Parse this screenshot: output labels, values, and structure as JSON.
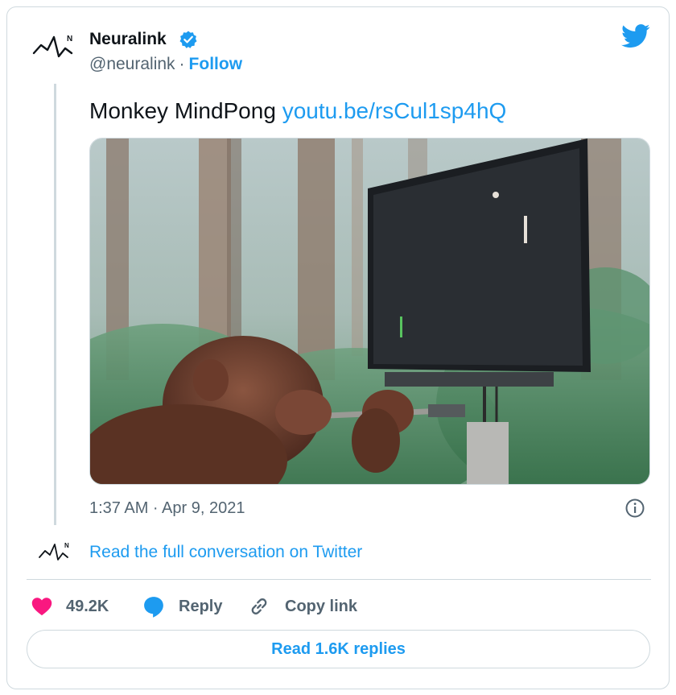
{
  "author": {
    "name": "Neuralink",
    "handle": "@neuralink",
    "separator": "·",
    "follow_label": "Follow"
  },
  "tweet": {
    "text": "Monkey MindPong ",
    "link": "youtu.be/rsCul1sp4hQ",
    "timestamp": "1:37 AM · Apr 9, 2021"
  },
  "footer": {
    "read_full_label": "Read the full conversation on Twitter"
  },
  "actions": {
    "likes_count": "49.2K",
    "reply_label": "Reply",
    "copy_link_label": "Copy link",
    "read_replies_label": "Read 1.6K replies"
  },
  "icons": {
    "logo": "neuralink-logo-icon",
    "verified": "verified-badge-icon",
    "twitter": "twitter-bird-icon",
    "info": "info-icon",
    "heart": "heart-icon",
    "reply": "reply-bubble-icon",
    "link": "link-icon"
  },
  "colors": {
    "accent": "#1d9bf0",
    "heart": "#f91880",
    "text": "#0f1419",
    "secondary": "#536471",
    "border": "#cfd9de"
  }
}
